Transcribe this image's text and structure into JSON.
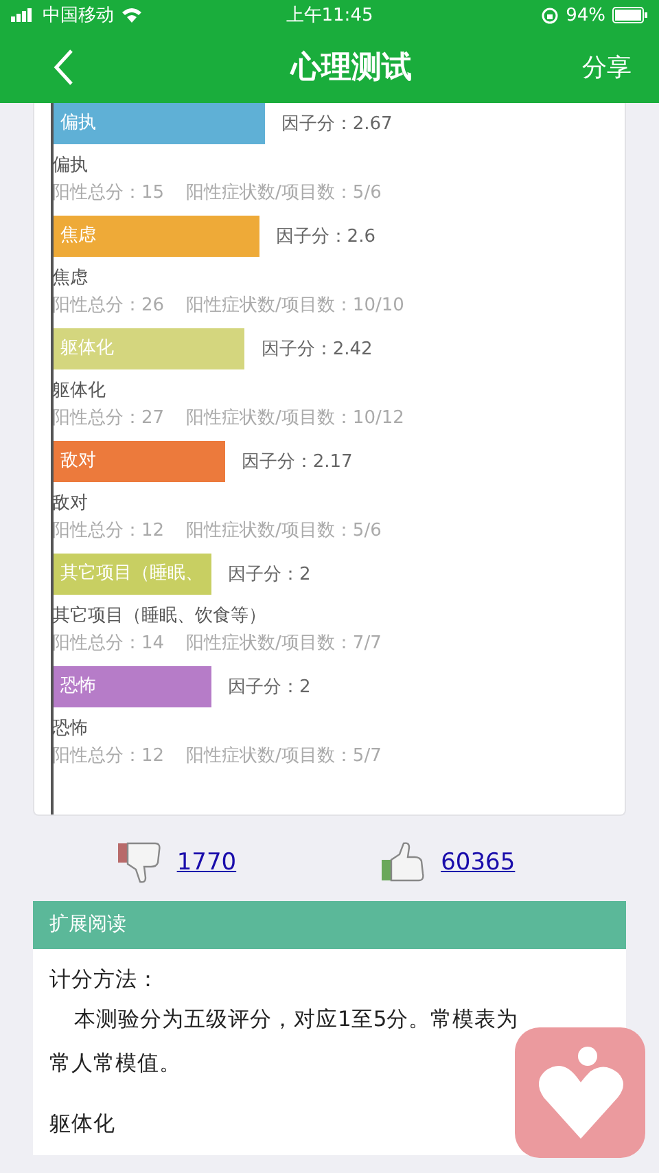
{
  "status_bar": {
    "carrier": "中国移动",
    "time": "上午11:45",
    "battery": "94%"
  },
  "nav": {
    "title": "心理测试",
    "action": "分享"
  },
  "factors": [
    {
      "bar_label": "偏执",
      "score": "因子分：2.67",
      "color": "#5fb0d6",
      "name": "偏执",
      "total": "阳性总分：15",
      "ratio": "阳性症状数/项目数：5/6"
    },
    {
      "bar_label": "焦虑",
      "score": "因子分：2.6",
      "color": "#eeaa38",
      "name": "焦虑",
      "total": "阳性总分：26",
      "ratio": "阳性症状数/项目数：10/10"
    },
    {
      "bar_label": "躯体化",
      "score": "因子分：2.42",
      "color": "#d4d67e",
      "name": "躯体化",
      "total": "阳性总分：27",
      "ratio": "阳性症状数/项目数：10/12"
    },
    {
      "bar_label": "敌对",
      "score": "因子分：2.17",
      "color": "#ec7a3c",
      "name": "敌对",
      "total": "阳性总分：12",
      "ratio": "阳性症状数/项目数：5/6"
    },
    {
      "bar_label": "其它项目（睡眠、",
      "score": "因子分：2",
      "color": "#c8cf62",
      "name": "其它项目（睡眠、饮食等）",
      "total": "阳性总分：14",
      "ratio": "阳性症状数/项目数：7/7"
    },
    {
      "bar_label": "恐怖",
      "score": "因子分：2",
      "color": "#b67cc8",
      "name": "恐怖",
      "total": "阳性总分：12",
      "ratio": "阳性症状数/项目数：5/7"
    }
  ],
  "votes": {
    "down": "1770",
    "up": "60365"
  },
  "reading": {
    "title": "扩展阅读",
    "subtitle": "计分方法：",
    "lines": [
      "本测验分为五级评分，对应1至5分。常模表为",
      "常人常模值。"
    ],
    "next_heading": "躯体化"
  }
}
